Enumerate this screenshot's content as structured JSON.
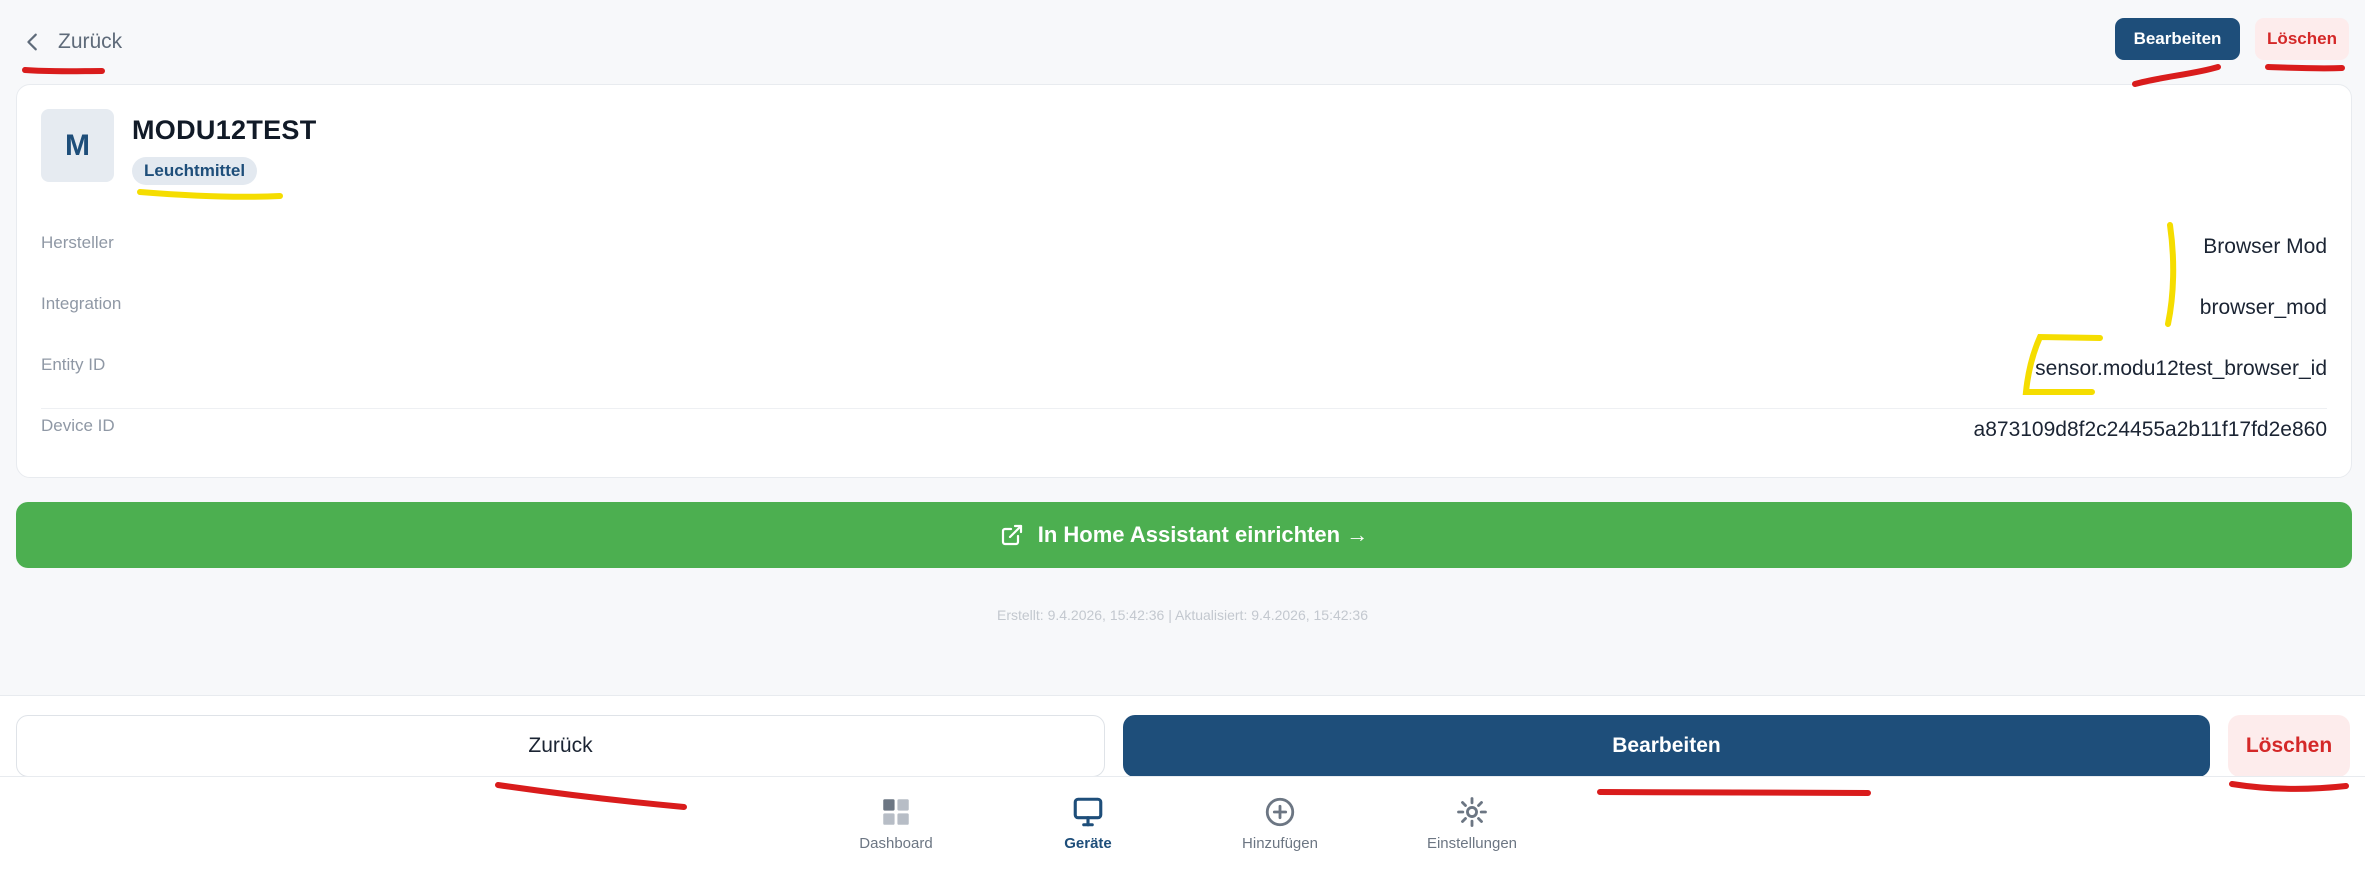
{
  "header": {
    "back_label": "Zurück",
    "edit_label": "Bearbeiten",
    "delete_label": "Löschen"
  },
  "device": {
    "avatar_letter": "M",
    "name": "MODU12TEST",
    "category": "Leuchtmittel",
    "details": [
      {
        "label": "Hersteller",
        "value": "Browser Mod"
      },
      {
        "label": "Integration",
        "value": "browser_mod"
      },
      {
        "label": "Entity ID",
        "value": "sensor.modu12test_browser_id"
      },
      {
        "label": "Device ID",
        "value": "a873109d8f2c24455a2b11f17fd2e860"
      }
    ]
  },
  "setup_button": {
    "label": "In Home Assistant einrichten →",
    "icon": "external-link-icon"
  },
  "timestamps": "Erstellt: 9.4.2026, 15:42:36 | Aktualisiert: 9.4.2026, 15:42:36",
  "actions": {
    "back_label": "Zurück",
    "edit_label": "Bearbeiten",
    "delete_label": "Löschen"
  },
  "nav": {
    "items": [
      {
        "label": "Dashboard",
        "icon": "dashboard-grid-icon",
        "active": false
      },
      {
        "label": "Geräte",
        "icon": "monitor-icon",
        "active": true
      },
      {
        "label": "Hinzufügen",
        "icon": "plus-circle-icon",
        "active": false
      },
      {
        "label": "Einstellungen",
        "icon": "gear-icon",
        "active": false
      }
    ]
  },
  "colors": {
    "primary": "#1e4e7a",
    "danger": "#d42828",
    "success": "#4caf50",
    "annotation_red": "#d91c1c",
    "annotation_yellow": "#f5dd00"
  }
}
